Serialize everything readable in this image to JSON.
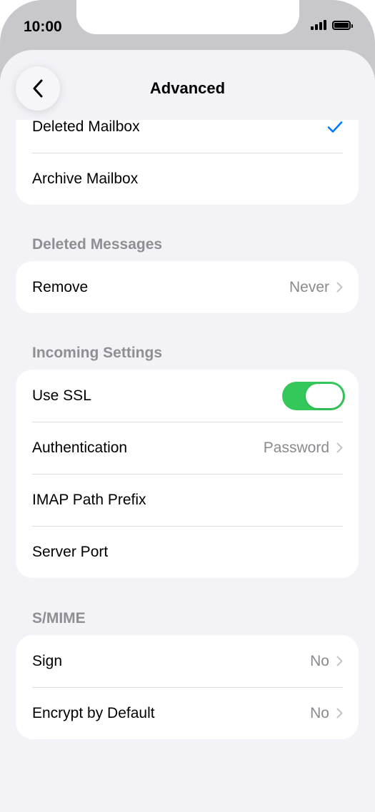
{
  "status_bar": {
    "time": "10:00"
  },
  "header": {
    "title": "Advanced"
  },
  "mailbox_group": {
    "items": [
      {
        "label": "Deleted Mailbox",
        "selected": true
      },
      {
        "label": "Archive Mailbox",
        "selected": false
      }
    ]
  },
  "deleted_messages": {
    "title": "Deleted Messages",
    "remove": {
      "label": "Remove",
      "value": "Never"
    }
  },
  "incoming_settings": {
    "title": "Incoming Settings",
    "use_ssl": {
      "label": "Use SSL",
      "on": true
    },
    "authentication": {
      "label": "Authentication",
      "value": "Password"
    },
    "imap_path_prefix": {
      "label": "IMAP Path Prefix"
    },
    "server_port": {
      "label": "Server Port"
    }
  },
  "smime": {
    "title": "S/MIME",
    "sign": {
      "label": "Sign",
      "value": "No"
    },
    "encrypt_by_default": {
      "label": "Encrypt by Default",
      "value": "No"
    }
  },
  "colors": {
    "accent": "#007aff",
    "toggle_on": "#34c759",
    "background": "#f2f2f7",
    "secondary_text": "#8e8e93"
  },
  "icons": {
    "back": "chevron-left-icon",
    "check": "checkmark-icon",
    "disclosure": "chevron-right-icon"
  }
}
